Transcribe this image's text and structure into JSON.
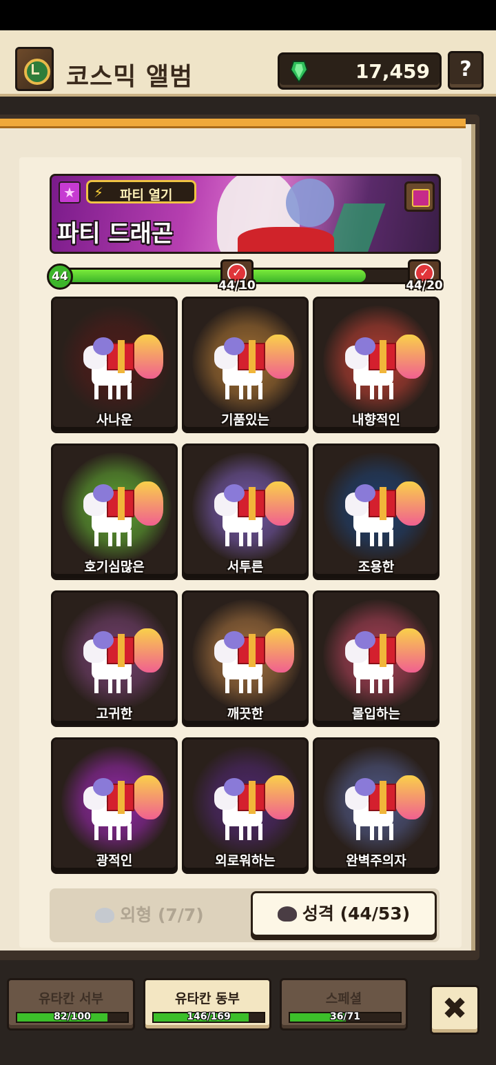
{
  "header": {
    "title": "코스믹 앨범",
    "currency_value": "17,459",
    "help_label": "?"
  },
  "banner": {
    "badge_label": "파티 열기",
    "title": "파티 드래곤"
  },
  "progress": {
    "level": "44",
    "current": 44,
    "max": 53,
    "milestones": [
      {
        "label": "44/10",
        "achieved": true
      },
      {
        "label": "44/20",
        "achieved": true
      }
    ]
  },
  "personalities": [
    {
      "label": "사나운",
      "glow": "#5a1a1a"
    },
    {
      "label": "기품있는",
      "glow": "#c9893a"
    },
    {
      "label": "내향적인",
      "glow": "#e0473a"
    },
    {
      "label": "호기심많은",
      "glow": "#6fd23a"
    },
    {
      "label": "서투른",
      "glow": "#8a6ad8"
    },
    {
      "label": "조용한",
      "glow": "#1a4a8a"
    },
    {
      "label": "고귀한",
      "glow": "#8a4a8a"
    },
    {
      "label": "깨끗한",
      "glow": "#c98a4a"
    },
    {
      "label": "몰입하는",
      "glow": "#d04a6a"
    },
    {
      "label": "광적인",
      "glow": "#b52ad6"
    },
    {
      "label": "외로워하는",
      "glow": "#5a2a8a"
    },
    {
      "label": "완벽주의자",
      "glow": "#5a6aa8"
    }
  ],
  "tabs": {
    "appearance": "외형 (7/7)",
    "personality": "성격 (44/53)"
  },
  "regions": [
    {
      "name": "유타칸 서부",
      "count": "82/100",
      "progress": 0.82,
      "active": false
    },
    {
      "name": "유타칸 동부",
      "count": "146/169",
      "progress": 0.864,
      "active": true
    },
    {
      "name": "스페셜",
      "count": "36/71",
      "progress": 0.507,
      "active": false
    }
  ],
  "close_label": "✖"
}
